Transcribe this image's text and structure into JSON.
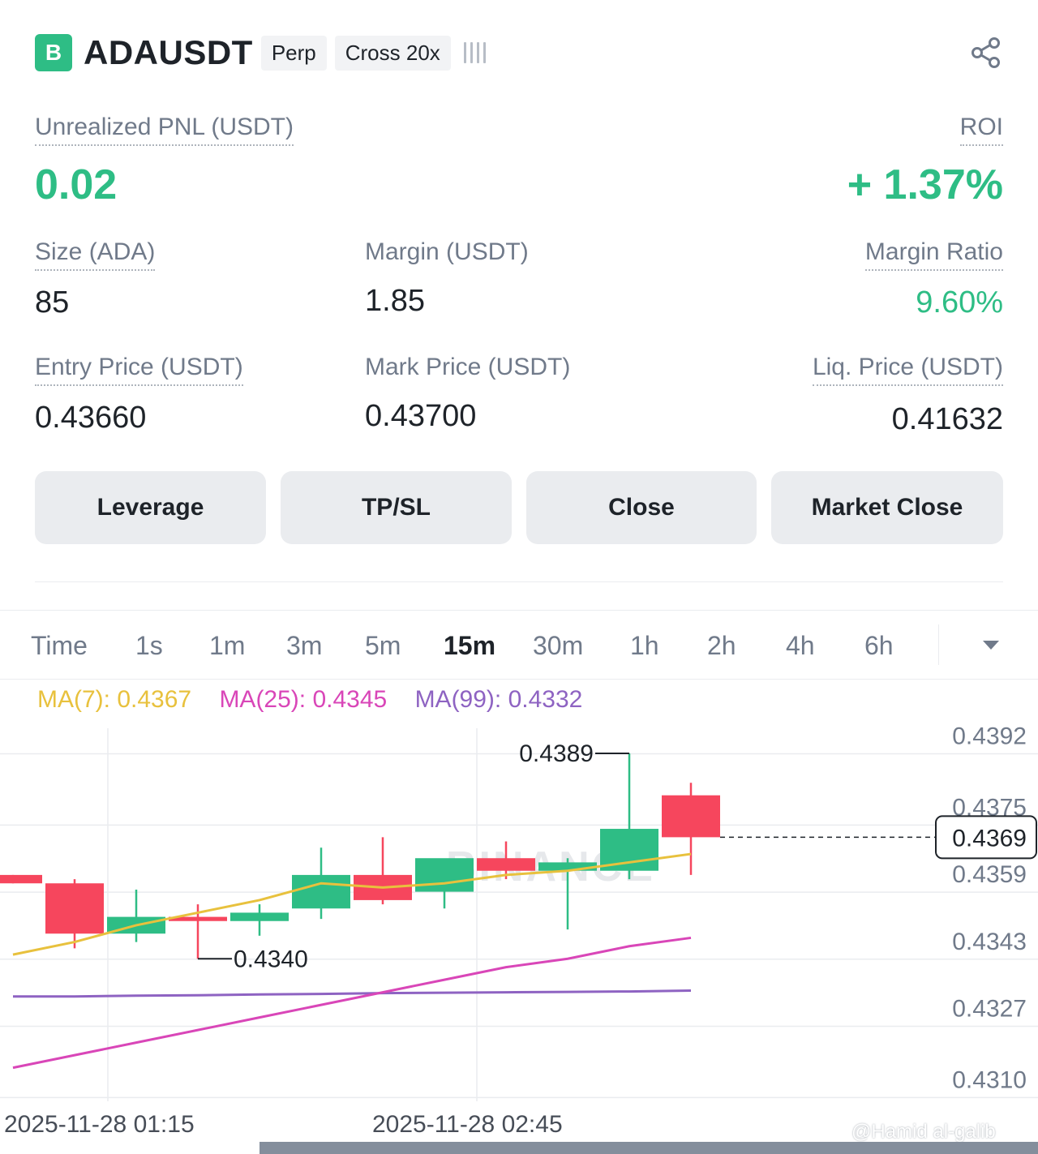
{
  "header": {
    "logo_letter": "B",
    "symbol": "ADAUSDT",
    "tags": [
      "Perp",
      "Cross 20x"
    ],
    "share_icon": "share-icon",
    "signal_icon": "signal-bars-icon"
  },
  "position": {
    "pnl_label": "Unrealized PNL (USDT)",
    "pnl_value": "0.02",
    "roi_label": "ROI",
    "roi_value": "+ 1.37%",
    "size_label": "Size (ADA)",
    "size_value": "85",
    "margin_label": "Margin (USDT)",
    "margin_value": "1.85",
    "margin_ratio_label": "Margin Ratio",
    "margin_ratio_value": "9.60%",
    "entry_label": "Entry Price (USDT)",
    "entry_value": "0.43660",
    "mark_label": "Mark Price (USDT)",
    "mark_value": "0.43700",
    "liq_label": "Liq. Price (USDT)",
    "liq_value": "0.41632"
  },
  "actions": {
    "leverage": "Leverage",
    "tpsl": "TP/SL",
    "close": "Close",
    "market_close": "Market Close"
  },
  "timeframes": {
    "items": [
      "Time",
      "1s",
      "1m",
      "3m",
      "5m",
      "15m",
      "30m",
      "1h",
      "2h",
      "4h",
      "6h"
    ],
    "active": "15m"
  },
  "indicators": {
    "ma7": "MA(7): 0.4367",
    "ma25": "MA(25): 0.4345",
    "ma99": "MA(99): 0.4332"
  },
  "colors": {
    "up": "#2ebd85",
    "down": "#f6465d",
    "ma7": "#e8c13d",
    "ma25": "#d946b8",
    "ma99": "#8e63c2",
    "accent_green": "#2ebd85"
  },
  "chart_data": {
    "type": "candlestick",
    "y_ticks": [
      "0.4392",
      "0.4375",
      "0.4359",
      "0.4343",
      "0.4327",
      "0.4310"
    ],
    "ylim": [
      0.4306,
      0.4395
    ],
    "x_ticks": [
      "2025-11-28 01:15",
      "2025-11-28 02:45"
    ],
    "current_price_label": "0.4369",
    "current_price": 0.4369,
    "high_annotation": "0.4389",
    "low_annotation": "0.4340",
    "watermark": "BINANCE",
    "candles": [
      {
        "o": 0.436,
        "h": 0.436,
        "l": 0.4358,
        "c": 0.4358
      },
      {
        "o": 0.4358,
        "h": 0.4359,
        "l": 0.43425,
        "c": 0.4346
      },
      {
        "o": 0.4346,
        "h": 0.43565,
        "l": 0.4344,
        "c": 0.435
      },
      {
        "o": 0.435,
        "h": 0.4353,
        "l": 0.434,
        "c": 0.4349
      },
      {
        "o": 0.4349,
        "h": 0.4353,
        "l": 0.43455,
        "c": 0.4351
      },
      {
        "o": 0.4352,
        "h": 0.43665,
        "l": 0.43495,
        "c": 0.436
      },
      {
        "o": 0.436,
        "h": 0.4369,
        "l": 0.4353,
        "c": 0.4354
      },
      {
        "o": 0.4356,
        "h": 0.4362,
        "l": 0.4352,
        "c": 0.4364
      },
      {
        "o": 0.4364,
        "h": 0.4368,
        "l": 0.4359,
        "c": 0.4361
      },
      {
        "o": 0.4361,
        "h": 0.4364,
        "l": 0.4347,
        "c": 0.4363
      },
      {
        "o": 0.4361,
        "h": 0.4389,
        "l": 0.4359,
        "c": 0.4371
      },
      {
        "o": 0.4379,
        "h": 0.4382,
        "l": 0.436,
        "c": 0.4369
      }
    ],
    "ma7_series": [
      0.4341,
      0.4344,
      0.4348,
      0.4351,
      0.4354,
      0.4358,
      0.4357,
      0.4358,
      0.436,
      0.4361,
      0.4363,
      0.4365
    ],
    "ma25_series": [
      0.4314,
      0.4317,
      0.432,
      0.4323,
      0.4326,
      0.4329,
      0.4332,
      0.4335,
      0.4338,
      0.434,
      0.4343,
      0.4345
    ],
    "ma99_series": [
      0.4331,
      0.4331,
      0.43312,
      0.43313,
      0.43315,
      0.43316,
      0.43318,
      0.43319,
      0.4332,
      0.43321,
      0.43322,
      0.43324
    ]
  },
  "footer": {
    "watermark_credit": "@Hamid al-galib"
  }
}
